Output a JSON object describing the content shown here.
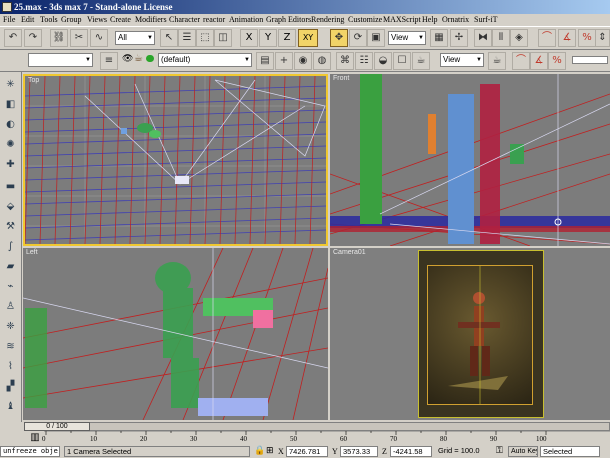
{
  "window": {
    "title": "25.max - 3ds max 7 - Stand-alone License"
  },
  "menu": [
    "File",
    "Edit",
    "Tools",
    "Group",
    "Views",
    "Create",
    "Modifiers",
    "Character",
    "reactor",
    "Animation",
    "Graph Editors",
    "Rendering",
    "Customize",
    "MAXScript",
    "Help",
    "Ornatrix",
    "Surf-iT"
  ],
  "toolbar": {
    "selection_filter": "All",
    "axis_x": "X",
    "axis_y": "Y",
    "axis_z": "Z",
    "axis_xy": "XY",
    "ref_coord": "View",
    "layer": "(default)",
    "view2": "View"
  },
  "viewports": {
    "top": "Top",
    "front": "Front",
    "left": "Left",
    "camera": "Camera01"
  },
  "timeline": {
    "slider": "0 / 100",
    "ticks": [
      "0",
      "10",
      "20",
      "30",
      "40",
      "50",
      "60",
      "70",
      "80",
      "90",
      "100"
    ]
  },
  "status": {
    "maxscript": "unfreeze obje",
    "selection": "1 Camera Selected",
    "x_label": "X",
    "x_value": "7426.781",
    "y_label": "Y",
    "y_value": "3573.33",
    "z_label": "Z",
    "z_value": "-4241.58",
    "grid": "Grid = 100.0",
    "autokey": "Auto Key",
    "selected": "Selected"
  },
  "colors": {
    "title_start": "#0a246a",
    "title_end": "#a6caf0",
    "active_border": "#f0c830",
    "toggle_on": "#f2d468"
  }
}
